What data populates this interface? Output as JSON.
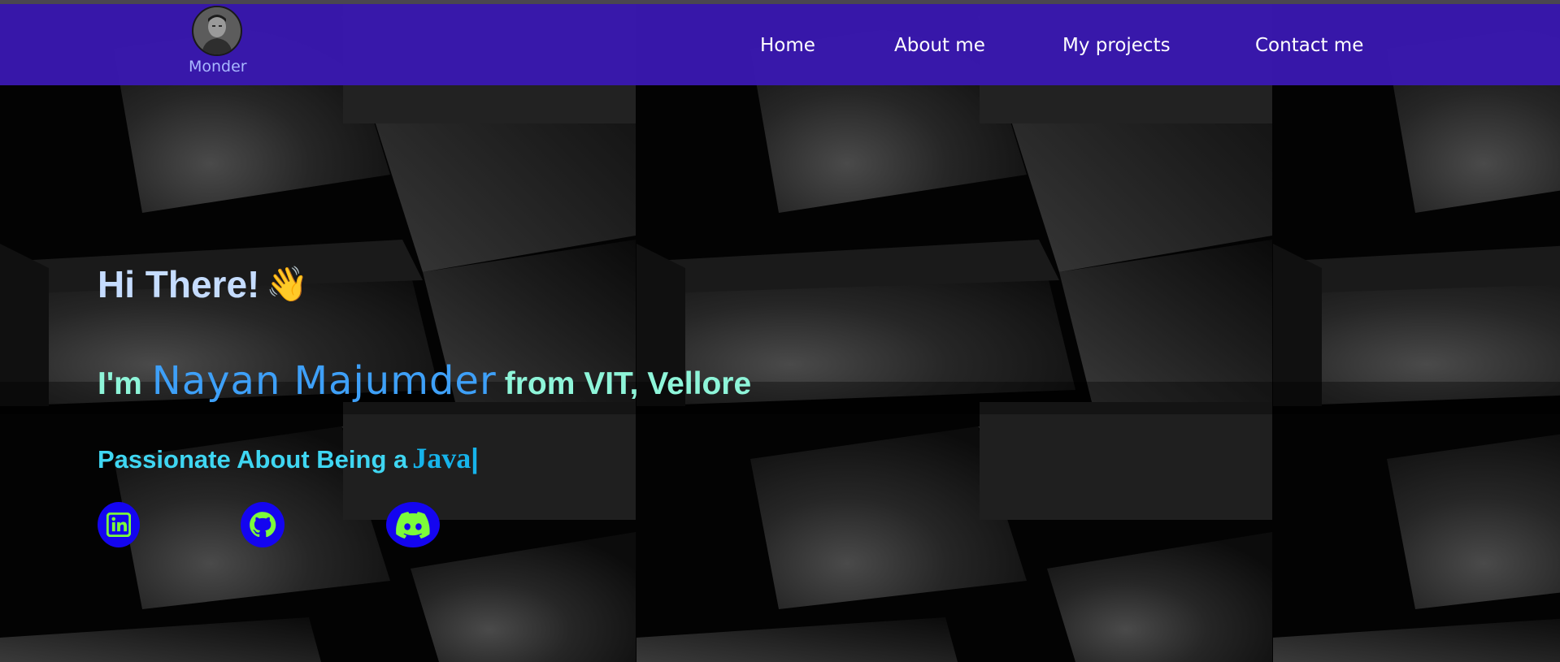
{
  "brand": {
    "name": "Monder",
    "avatar_icon": "profile-photo-avatar"
  },
  "nav": {
    "items": [
      {
        "label": "Home"
      },
      {
        "label": "About me"
      },
      {
        "label": "My projects"
      },
      {
        "label": "Contact me"
      }
    ]
  },
  "hero": {
    "greeting": "Hi There!",
    "wave_emoji": "👋",
    "intro_prefix": "I'm",
    "name": "Nayan Majumder",
    "intro_suffix": "from VIT, Vellore",
    "passion_lead": "Passionate About Being a",
    "passion_typed": "Java",
    "cursor": "|"
  },
  "socials": [
    {
      "name": "LinkedIn",
      "icon": "linkedin-icon"
    },
    {
      "name": "GitHub",
      "icon": "github-icon"
    },
    {
      "name": "Discord",
      "icon": "discord-icon"
    }
  ],
  "colors": {
    "navbar": "#3a18b2",
    "greeting": "#c5dcff",
    "intro": "#8ef5d9",
    "name": "#3ea0f8",
    "passion": "#3fd6f2",
    "social_bg": "#1405f0",
    "social_icon": "#7cfc3a"
  }
}
